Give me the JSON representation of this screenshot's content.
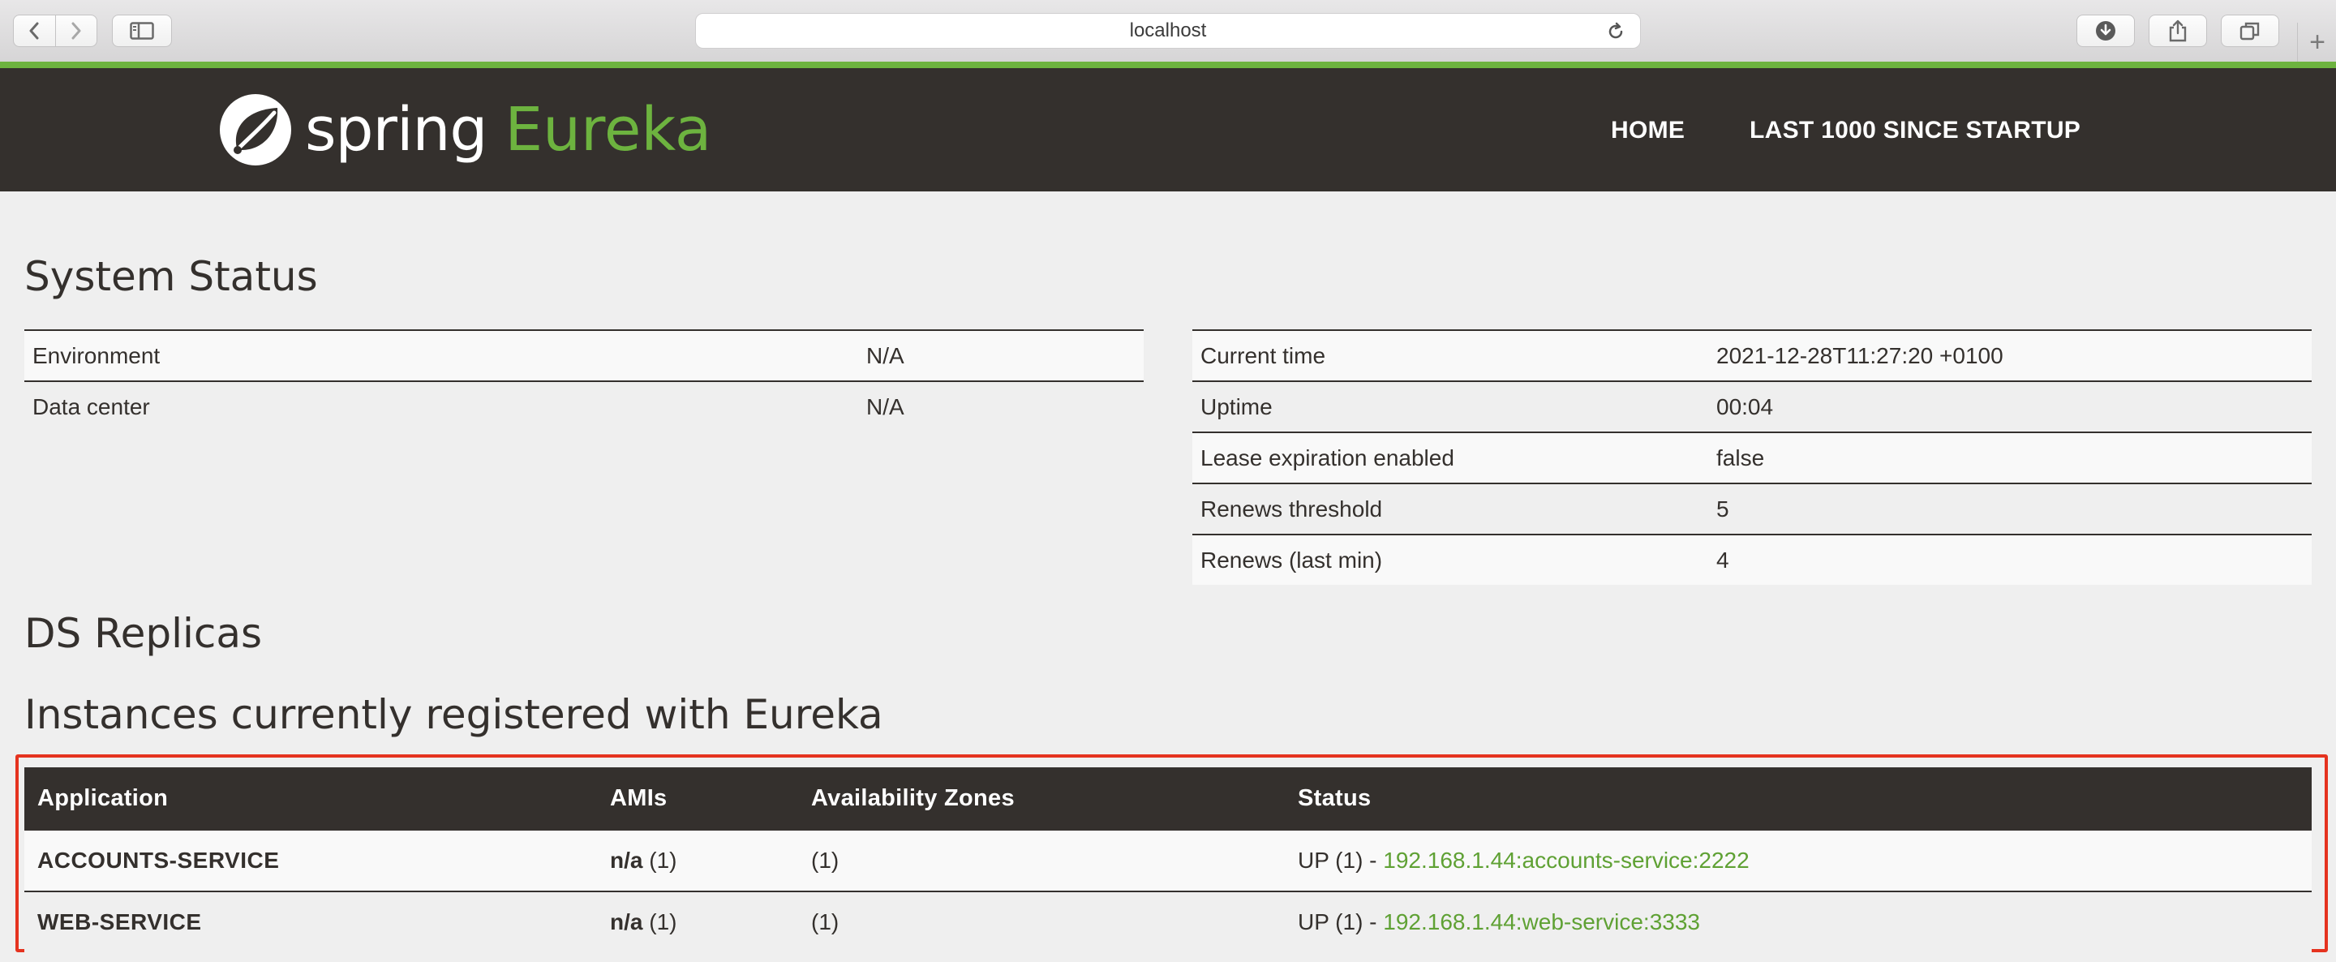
{
  "browser": {
    "address": "localhost"
  },
  "brand": {
    "spring": "spring",
    "eureka": "Eureka",
    "accent": "#6db33f",
    "header_bg": "#34302d",
    "highlight_border": "#e5331f"
  },
  "nav": {
    "home": "HOME",
    "last1000": "LAST 1000 SINCE STARTUP"
  },
  "system_status": {
    "title": "System Status",
    "env_table": [
      {
        "key": "Environment",
        "value": "N/A"
      },
      {
        "key": "Data center",
        "value": "N/A"
      }
    ],
    "info_table": [
      {
        "key": "Current time",
        "value": "2021-12-28T11:27:20 +0100"
      },
      {
        "key": "Uptime",
        "value": "00:04"
      },
      {
        "key": "Lease expiration enabled",
        "value": "false"
      },
      {
        "key": "Renews threshold",
        "value": "5"
      },
      {
        "key": "Renews (last min)",
        "value": "4"
      }
    ]
  },
  "replicas": {
    "title": "DS Replicas"
  },
  "instances": {
    "title": "Instances currently registered with Eureka",
    "headers": [
      "Application",
      "AMIs",
      "Availability Zones",
      "Status"
    ],
    "rows": [
      {
        "app": "ACCOUNTS-SERVICE",
        "ami": "n/a",
        "ami_count": "(1)",
        "zones": "(1)",
        "status": "UP (1) - ",
        "link": "192.168.1.44:accounts-service:2222"
      },
      {
        "app": "WEB-SERVICE",
        "ami": "n/a",
        "ami_count": "(1)",
        "zones": "(1)",
        "status": "UP (1) - ",
        "link": "192.168.1.44:web-service:3333"
      }
    ]
  }
}
